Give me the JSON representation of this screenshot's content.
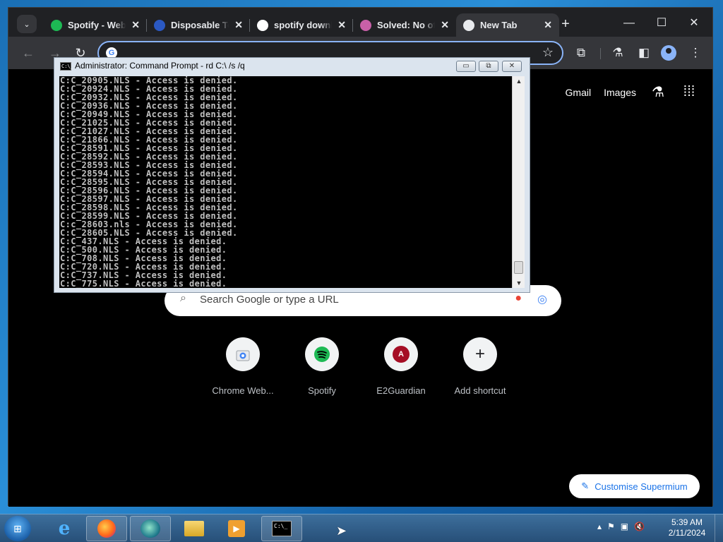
{
  "browser": {
    "tabs": [
      {
        "title": "Spotify - Web Player",
        "favicon": "spotify-icon",
        "color": "#1db954",
        "active": false
      },
      {
        "title": "Disposable Temp Mail",
        "favicon": "t-icon",
        "color": "#2b59c3",
        "active": false
      },
      {
        "title": "spotify download",
        "favicon": "google-icon",
        "color": "#ffffff",
        "active": false
      },
      {
        "title": "Solved: No offline",
        "favicon": "spotify-community-icon",
        "color": "#c860a8",
        "active": false
      },
      {
        "title": "New Tab",
        "favicon": "newtab-icon",
        "color": "#e8eaed",
        "active": true
      }
    ],
    "top_links": {
      "gmail": "Gmail",
      "images": "Images"
    },
    "search_placeholder": "Search Google or type a URL",
    "shortcuts": [
      {
        "label": "Chrome Web...",
        "icon": "chrome-web-store-icon"
      },
      {
        "label": "Spotify",
        "icon": "spotify-icon"
      },
      {
        "label": "E2Guardian",
        "icon": "e2guardian-icon",
        "letter": "A"
      },
      {
        "label": "Add shortcut",
        "icon": "plus-icon"
      }
    ],
    "customise_label": "Customise Supermium"
  },
  "cmd": {
    "title": "Administrator:  Command Prompt - rd  C:\\ /s /q",
    "lines": [
      "C:C_20905.NLS - Access is denied.",
      "C:C_20924.NLS - Access is denied.",
      "C:C_20932.NLS - Access is denied.",
      "C:C_20936.NLS - Access is denied.",
      "C:C_20949.NLS - Access is denied.",
      "C:C_21025.NLS - Access is denied.",
      "C:C_21027.NLS - Access is denied.",
      "C:C_21866.NLS - Access is denied.",
      "C:C_28591.NLS - Access is denied.",
      "C:C_28592.NLS - Access is denied.",
      "C:C_28593.NLS - Access is denied.",
      "C:C_28594.NLS - Access is denied.",
      "C:C_28595.NLS - Access is denied.",
      "C:C_28596.NLS - Access is denied.",
      "C:C_28597.NLS - Access is denied.",
      "C:C_28598.NLS - Access is denied.",
      "C:C_28599.NLS - Access is denied.",
      "C:c_28603.nls - Access is denied.",
      "C:C_28605.NLS - Access is denied.",
      "C:C_437.NLS - Access is denied.",
      "C:C_500.NLS - Access is denied.",
      "C:C_708.NLS - Access is denied.",
      "C:C_720.NLS - Access is denied.",
      "C:C_737.NLS - Access is denied.",
      "C:C_775.NLS - Access is denied."
    ]
  },
  "taskbar": {
    "clock_time": "5:39 AM",
    "clock_date": "2/11/2024"
  }
}
